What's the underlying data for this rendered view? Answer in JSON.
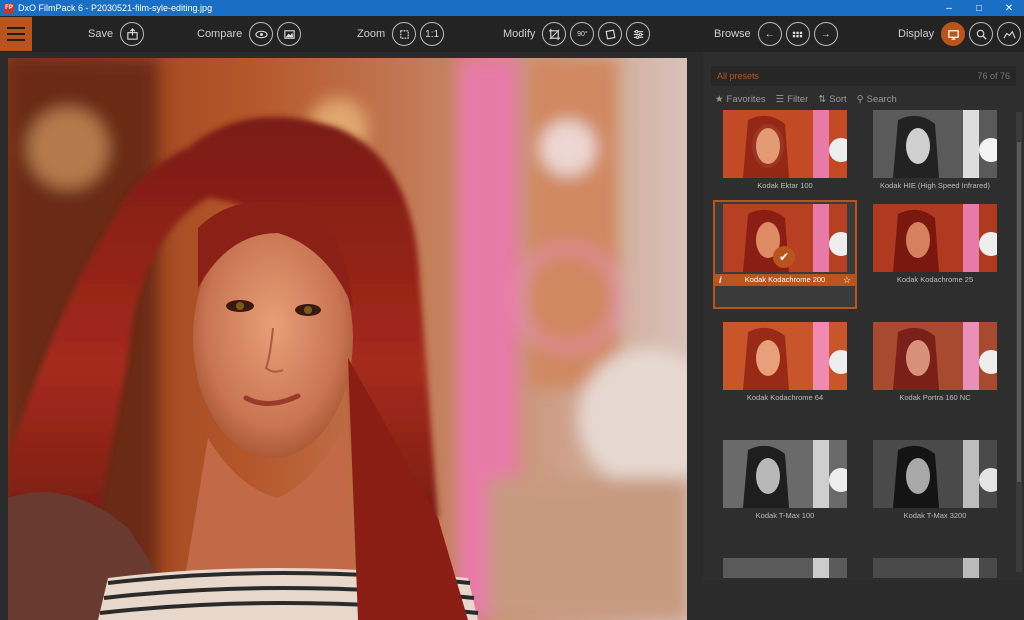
{
  "window": {
    "title": "DxO FilmPack 6 - P2030521-film-syle-editing.jpg",
    "app_icon": "FP"
  },
  "toolbar": {
    "save_label": "Save",
    "compare_label": "Compare",
    "zoom_label": "Zoom",
    "zoom_1to1": "1:1",
    "modify_label": "Modify",
    "rotate_label": "90°",
    "browse_label": "Browse",
    "display_label": "Display"
  },
  "panel": {
    "presets_label": "All presets",
    "count": "76 of 76",
    "filters": {
      "favorites": "Favorites",
      "filter": "Filter",
      "sort": "Sort",
      "search": "Search"
    },
    "presets": [
      {
        "name": "Kodak Ektar 100",
        "style": "warm"
      },
      {
        "name": "Kodak HIE (High Speed Infrared)",
        "style": "bw"
      },
      {
        "name": "Kodak Kodachrome 200",
        "style": "warm",
        "selected": true
      },
      {
        "name": "Kodak Kodachrome 25",
        "style": "warm"
      },
      {
        "name": "Kodak Kodachrome 64",
        "style": "warm"
      },
      {
        "name": "Kodak Portra 160 NC",
        "style": "warm"
      },
      {
        "name": "Kodak T-Max 100",
        "style": "bw"
      },
      {
        "name": "Kodak T-Max 3200",
        "style": "bw"
      }
    ]
  },
  "colors": {
    "accent": "#b8551f",
    "titlebar": "#1a6fc4"
  }
}
